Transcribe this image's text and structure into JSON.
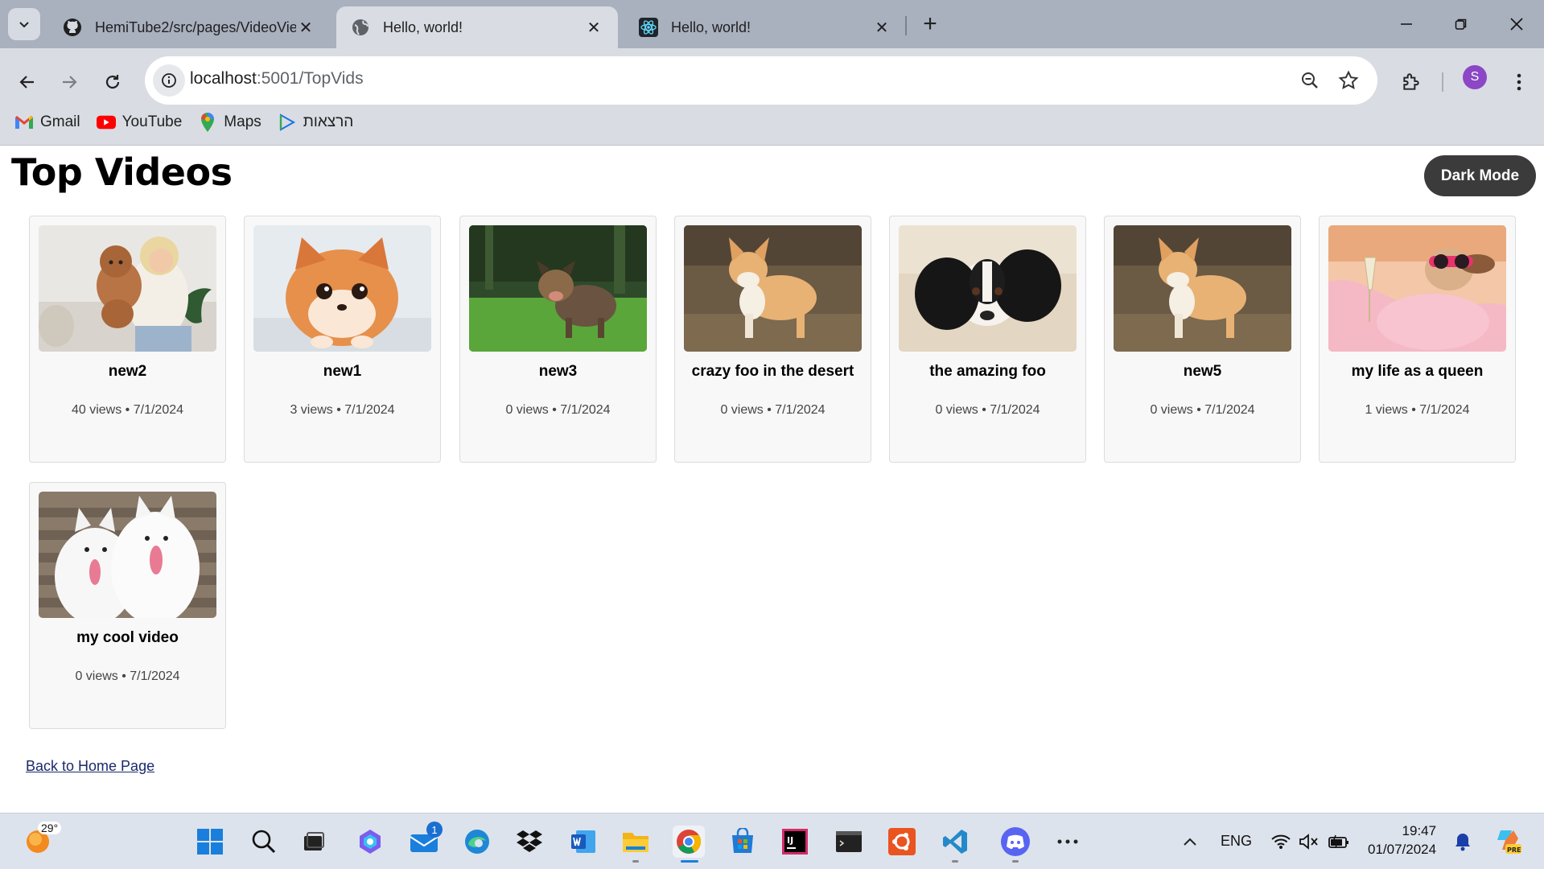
{
  "browser": {
    "tabs": [
      {
        "title": "HemiTube2/src/pages/VideoVie",
        "icon": "github-icon",
        "active": false
      },
      {
        "title": "Hello, world!",
        "icon": "globe-icon",
        "active": true
      },
      {
        "title": "Hello, world!",
        "icon": "react-icon",
        "active": false
      }
    ],
    "url_host": "localhost",
    "url_rest": ":5001/TopVids",
    "profile_initial": "S",
    "bookmarks": [
      {
        "label": "Gmail",
        "icon": "gmail-icon"
      },
      {
        "label": "YouTube",
        "icon": "youtube-icon"
      },
      {
        "label": "Maps",
        "icon": "maps-icon"
      },
      {
        "label": "הרצאות",
        "icon": "bookmark-app-icon"
      }
    ]
  },
  "page": {
    "title": "Top Videos",
    "dark_mode_label": "Dark Mode",
    "back_link": "Back to Home Page",
    "videos": [
      {
        "title": "new2",
        "meta": "40 views • 7/1/2024",
        "thumb": "woman-with-poodle"
      },
      {
        "title": "new1",
        "meta": "3 views • 7/1/2024",
        "thumb": "fluffy-puppy"
      },
      {
        "title": "new3",
        "meta": "0 views • 7/1/2024",
        "thumb": "dog-on-grass"
      },
      {
        "title": "crazy foo in the desert",
        "meta": "0 views • 7/1/2024",
        "thumb": "corgi"
      },
      {
        "title": "the amazing foo",
        "meta": "0 views • 7/1/2024",
        "thumb": "spaniel-lying"
      },
      {
        "title": "new5",
        "meta": "0 views • 7/1/2024",
        "thumb": "corgi"
      },
      {
        "title": "my life as a queen",
        "meta": "1 views • 7/1/2024",
        "thumb": "dog-in-robe"
      },
      {
        "title": "my cool video",
        "meta": "0 views • 7/1/2024",
        "thumb": "two-samoyeds"
      }
    ]
  },
  "taskbar": {
    "temperature": "29°",
    "mail_badge": "1",
    "language": "ENG",
    "time": "19:47",
    "date": "01/07/2024"
  },
  "colors": {
    "tabbar": "#a9b0be",
    "toolbar": "#d9dce3",
    "dark_button": "#3b3b3b",
    "card_bg": "#f8f8f8",
    "link": "#1a2a6c"
  }
}
